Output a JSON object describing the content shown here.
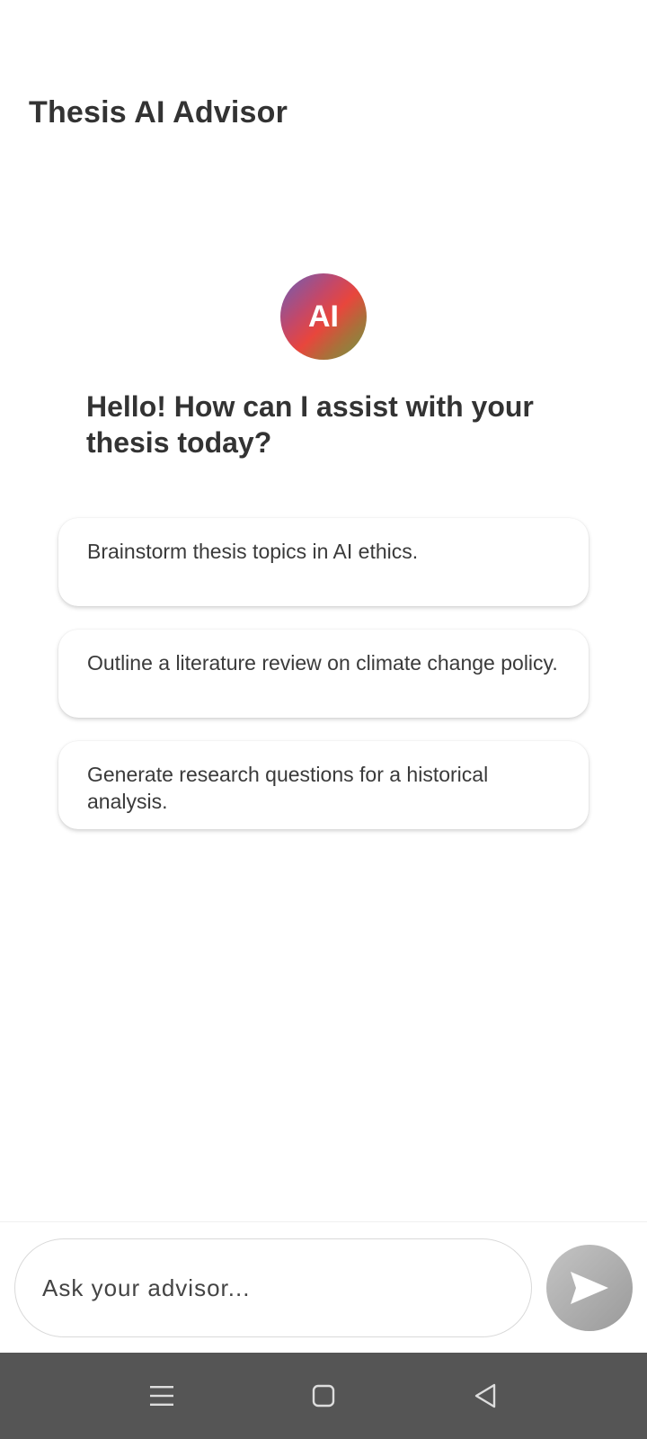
{
  "app": {
    "title": "Thesis AI Advisor"
  },
  "assistant": {
    "avatar_label": "AI",
    "greeting": "Hello! How can I assist with your thesis today?"
  },
  "suggestions": [
    {
      "text": "Brainstorm thesis topics in AI ethics."
    },
    {
      "text": "Outline a literature review on climate change policy."
    },
    {
      "text": "Generate research questions for a historical analysis."
    }
  ],
  "composer": {
    "placeholder": "Ask your advisor...",
    "value": "",
    "send_icon": "send-icon"
  },
  "navigation": {
    "menu_icon": "menu-icon",
    "home_icon": "home-icon",
    "back_icon": "back-icon"
  },
  "colors": {
    "text": "#333333",
    "send_button": "#a8a8a8",
    "nav_bar": "#555555"
  }
}
